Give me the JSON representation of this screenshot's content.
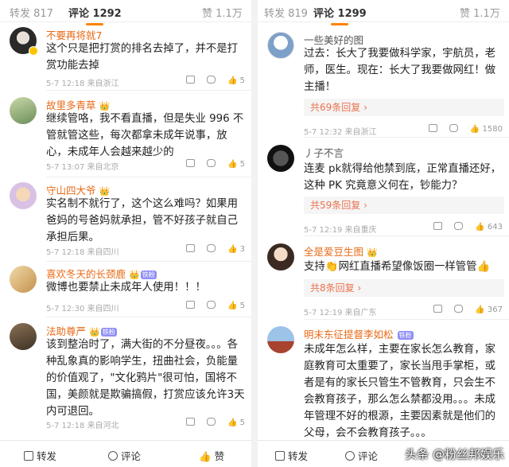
{
  "left": {
    "tabs": {
      "repost": "转发 817",
      "comment": "评论 1292",
      "like": "赞 1.1万"
    },
    "comments": [
      {
        "name": "不要再将就7",
        "text": "这个只是把打赏的排名去掉了，并不是打赏功能去掉",
        "meta": "5-7 12:18 来自浙江",
        "likes": "5"
      },
      {
        "name": "故里多青草",
        "text": "继续管咯，我不看直播，但是失业 996 不管就管这些，每次都拿未成年说事，放心，未成年人会越来越少的",
        "meta": "5-7 13:07 来自北京",
        "likes": "5"
      },
      {
        "name": "守山四大爷",
        "text": "实名制不就行了，这个这么难吗？如果用爸妈的号爸妈就承担，管不好孩子就自己承担后果。",
        "meta": "5-7 12:18 来自四川",
        "likes": "3"
      },
      {
        "name": "喜欢冬天的长颈鹿",
        "tag": "铁粉",
        "text": "微博也要禁止未成年人使用！！！",
        "meta": "5-7 12:30 来自四川",
        "likes": "5"
      },
      {
        "name": "法助尊严",
        "tag": "铁粉",
        "text": "该到整治时了，满大街的不分昼夜。。。各种乱象真的影响学生，扭曲社会，负能量的价值观了，\"文化鸦片\"很可怕，国将不国，美颜就是欺骗搞假，打赏应该允许3天内可退回。",
        "meta": "5-7 12:18 来自河北",
        "likes": "5"
      }
    ],
    "bottom": {
      "repost": "转发",
      "comment": "评论",
      "like": "赞"
    }
  },
  "right": {
    "tabs": {
      "repost": "转发 819",
      "comment": "评论 1299",
      "like": "赞 1.1万"
    },
    "comments": [
      {
        "name": "一些美好的图",
        "text": "过去：长大了我要做科学家，宇航员，老师，医生。现在：长大了我要做网红！做主播！",
        "replies": "共69条回复 ›",
        "meta": "5-7 12:32 来自浙江",
        "likes": "1580"
      },
      {
        "name": "丿子不言",
        "text": "连麦 pk就得给他禁到底，正常直播还好，这种 PK 究竟意义何在，钞能力？",
        "replies": "共59条回复 ›",
        "meta": "5-7 12:19 来自重庆",
        "likes": "643"
      },
      {
        "name": "全是爱豆生图",
        "text": "支持👏网红直播希望像饭圈一样管管👍",
        "replies": "共8条回复 ›",
        "meta": "5-7 12:19 来自广东",
        "likes": "367"
      },
      {
        "name": "明末东征提督李如松",
        "tag": "铁粉",
        "text": "未成年怎么样，主要在家长怎么教育，家庭教育可太重要了，家长当甩手掌柜，或者是有的家长只管生不管教育，只会生不会教育孩子，那么怎么禁都没用。。。未成年管理不好的根源，主要因素就是他们的父母，会不会教育孩子。。。",
        "meta": "",
        "likes": ""
      }
    ],
    "bottom": {
      "repost": "转发",
      "comment": "评论"
    },
    "watermark": "头条 @粉丝邦娱乐"
  }
}
